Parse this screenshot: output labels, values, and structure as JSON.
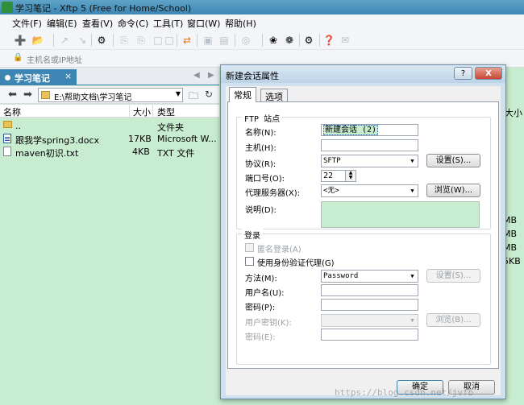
{
  "window": {
    "title": "学习笔记 - Xftp 5 (Free for Home/School)"
  },
  "menu": [
    "文件(F)",
    "编辑(E)",
    "查看(V)",
    "命令(C)",
    "工具(T)",
    "窗口(W)",
    "帮助(H)"
  ],
  "address": {
    "placeholder": "主机名或IP地址"
  },
  "tab": {
    "label": "学习笔记",
    "close": "×"
  },
  "path": {
    "value": "E:\\帮助文档\\学习笔记"
  },
  "list": {
    "headers": {
      "name": "名称",
      "size": "大小",
      "type": "类型"
    },
    "rows": [
      {
        "name": "..",
        "size": "",
        "type": "文件夹",
        "icon": "folder-icon"
      },
      {
        "name": "跟我学spring3.docx",
        "size": "17KB",
        "type": "Microsoft W...",
        "icon": "word-doc-icon"
      },
      {
        "name": "maven初识.txt",
        "size": "4KB",
        "type": "TXT 文件",
        "icon": "text-file-icon"
      }
    ]
  },
  "right_pane": {
    "size_header": "大小",
    "sizes": [
      "MB",
      "MB",
      "MB",
      "5KB"
    ]
  },
  "dialog": {
    "title": "新建会话属性",
    "help": "?",
    "close": "X",
    "tabs": [
      "常规",
      "选项"
    ],
    "ftp_group": "FTP 站点",
    "name_label": "名称(N):",
    "name_value": "新建会话 (2)",
    "host_label": "主机(H):",
    "host_value": "",
    "protocol_label": "协议(R):",
    "protocol_value": "SFTP",
    "settings_button": "设置(S)...",
    "port_label": "端口号(O):",
    "port_value": "22",
    "proxy_label": "代理服务器(X):",
    "proxy_value": "<无>",
    "browse_button": "浏览(W)...",
    "desc_label": "说明(D):",
    "login_group": "登录",
    "anonymous_label": "匿名登录(A)",
    "agent_label": "使用身份验证代理(G)",
    "method_label": "方法(M):",
    "method_value": "Password",
    "method_settings_button": "设置(S)...",
    "user_label": "用户名(U):",
    "password_label": "密码(P):",
    "userkey_label": "用户密钥(K):",
    "key_browse_button": "浏览(B)...",
    "passphrase_label": "密码(E):",
    "ok_button": "确定",
    "cancel_button": "取消"
  },
  "watermark": "https://blog.csdn.net/jvfb"
}
